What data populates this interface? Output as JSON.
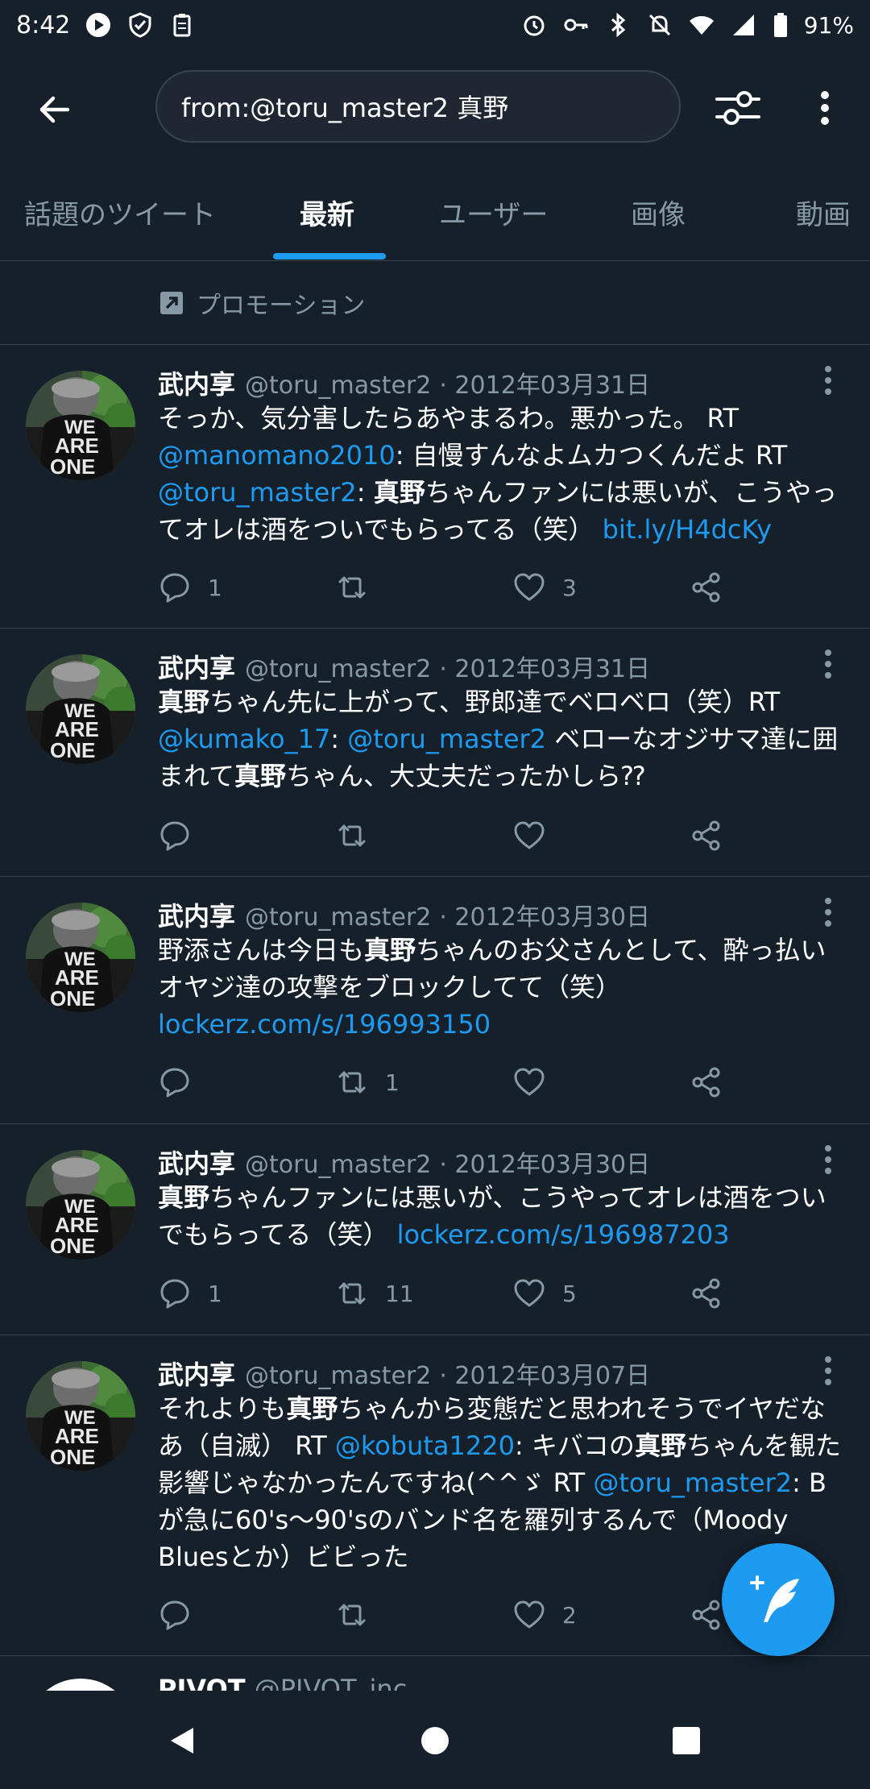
{
  "status_bar": {
    "time": "8:42",
    "battery": "91%",
    "left_icons": [
      "play-icon",
      "shield-icon",
      "clipboard-icon"
    ],
    "right_icons": [
      "alarm-icon",
      "key-icon",
      "bluetooth-icon",
      "mute-icon",
      "wifi-icon",
      "signal-icon",
      "battery-icon"
    ]
  },
  "search": {
    "query": "from:@toru_master2 真野"
  },
  "tabs": [
    {
      "label": "話題のツイート",
      "active": false
    },
    {
      "label": "最新",
      "active": true
    },
    {
      "label": "ユーザー",
      "active": false
    },
    {
      "label": "画像",
      "active": false
    },
    {
      "label": "動画",
      "active": false
    }
  ],
  "promo": {
    "label": "プロモーション"
  },
  "tweets": [
    {
      "name": "武内享",
      "handle": "@toru_master2",
      "date": "· 2012年03月31日",
      "reply_count": "1",
      "retweet_count": "",
      "like_count": "3",
      "segments": [
        {
          "t": "そっか、気分害したらあやまるわ。悪かった。 RT ",
          "k": "text"
        },
        {
          "t": "@manomano2010",
          "k": "link"
        },
        {
          "t": ": 自慢すんなよムカつくんだよ RT ",
          "k": "text"
        },
        {
          "t": "@toru_master2",
          "k": "link"
        },
        {
          "t": ": ",
          "k": "text"
        },
        {
          "t": "真野",
          "k": "bold"
        },
        {
          "t": "ちゃんファンには悪いが、こうやってオレは酒をついでもらってる（笑） ",
          "k": "text"
        },
        {
          "t": "bit.ly/H4dcKy",
          "k": "link"
        }
      ]
    },
    {
      "name": "武内享",
      "handle": "@toru_master2",
      "date": "· 2012年03月31日",
      "reply_count": "",
      "retweet_count": "",
      "like_count": "",
      "segments": [
        {
          "t": "真野",
          "k": "bold"
        },
        {
          "t": "ちゃん先に上がって、野郎達でベロベロ（笑）RT ",
          "k": "text"
        },
        {
          "t": "@kumako_17",
          "k": "link"
        },
        {
          "t": ": ",
          "k": "text"
        },
        {
          "t": "@toru_master2",
          "k": "link"
        },
        {
          "t": " ベローなオジサマ達に囲まれて",
          "k": "text"
        },
        {
          "t": "真野",
          "k": "bold"
        },
        {
          "t": "ちゃん、大丈夫だったかしら⁇",
          "k": "text"
        }
      ]
    },
    {
      "name": "武内享",
      "handle": "@toru_master2",
      "date": "· 2012年03月30日",
      "reply_count": "",
      "retweet_count": "1",
      "like_count": "",
      "segments": [
        {
          "t": "野添さんは今日も",
          "k": "text"
        },
        {
          "t": "真野",
          "k": "bold"
        },
        {
          "t": "ちゃんのお父さんとして、酔っ払いオヤジ達の攻撃をブロックしてて（笑） ",
          "k": "text"
        },
        {
          "t": "lockerz.com/s/196993150",
          "k": "link"
        }
      ]
    },
    {
      "name": "武内享",
      "handle": "@toru_master2",
      "date": "· 2012年03月30日",
      "reply_count": "1",
      "retweet_count": "11",
      "like_count": "5",
      "segments": [
        {
          "t": "真野",
          "k": "bold"
        },
        {
          "t": "ちゃんファンには悪いが、こうやってオレは酒をついでもらってる（笑） ",
          "k": "text"
        },
        {
          "t": "lockerz.com/s/196987203",
          "k": "link"
        }
      ]
    },
    {
      "name": "武内享",
      "handle": "@toru_master2",
      "date": "· 2012年03月07日",
      "reply_count": "",
      "retweet_count": "",
      "like_count": "2",
      "segments": [
        {
          "t": "それよりも",
          "k": "text"
        },
        {
          "t": "真野",
          "k": "bold"
        },
        {
          "t": "ちゃんから変態だと思われそうでイヤだなあ（自滅） RT ",
          "k": "text"
        },
        {
          "t": "@kobuta1220",
          "k": "link"
        },
        {
          "t": ": キバコの",
          "k": "text"
        },
        {
          "t": "真野",
          "k": "bold"
        },
        {
          "t": "ちゃんを観た影響じゃなかったんですね(^^ゞ RT ",
          "k": "text"
        },
        {
          "t": "@toru_master2",
          "k": "link"
        },
        {
          "t": ": Bが急に60's〜90'sのバンド名を羅列するんで（Moody Bluesとか）ビビった",
          "k": "text"
        }
      ]
    }
  ],
  "next_partial": {
    "name": "PIVOT",
    "handle": "@PIVOT_inc"
  },
  "colors": {
    "background": "#15202b",
    "accent": "#1d9bf0",
    "muted": "#8899a6",
    "divider": "#38444d"
  }
}
